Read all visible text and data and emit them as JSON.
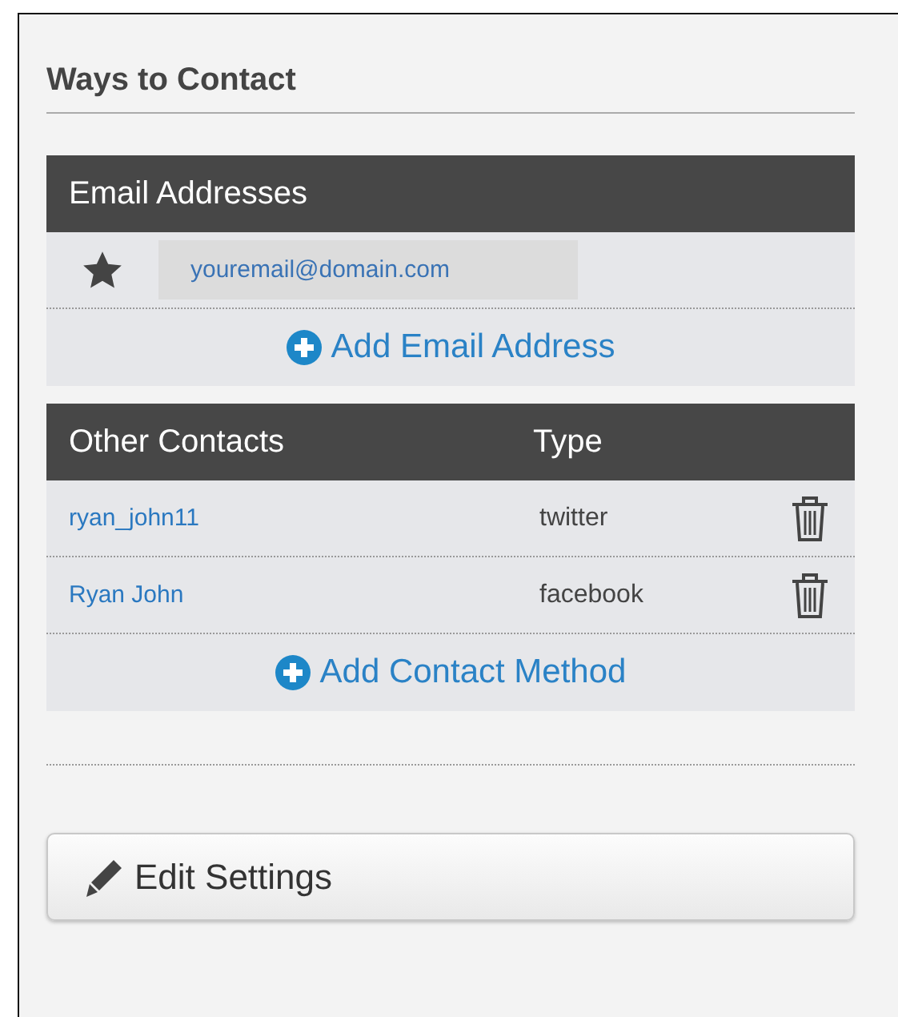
{
  "title": "Ways to Contact",
  "email_section": {
    "heading": "Email Addresses",
    "emails": [
      {
        "address": "youremail@domain.com",
        "primary": true
      }
    ],
    "add_label": "Add Email Address"
  },
  "contacts_section": {
    "columns": [
      "Other Contacts",
      "Type"
    ],
    "rows": [
      {
        "handle": "ryan_john11",
        "type": "twitter"
      },
      {
        "handle": "Ryan John",
        "type": "facebook"
      }
    ],
    "add_label": "Add Contact Method"
  },
  "button": "Edit Settings"
}
